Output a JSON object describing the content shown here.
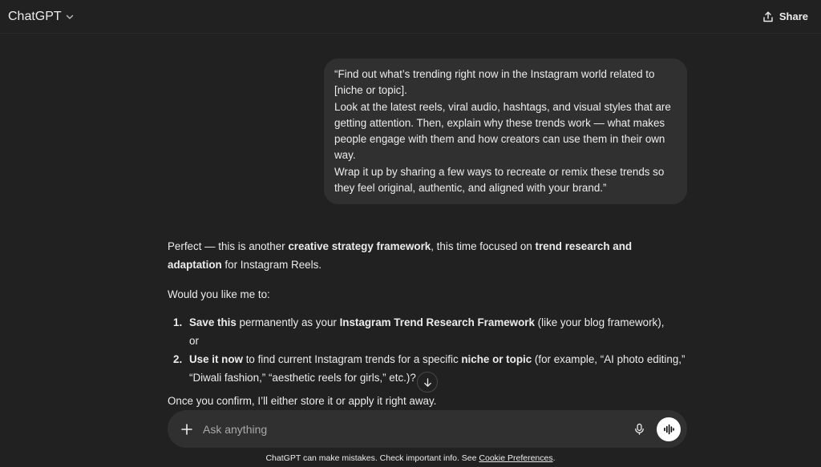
{
  "header": {
    "model_name": "ChatGPT",
    "share_label": "Share"
  },
  "user_message": {
    "lines": [
      "“Find out what’s trending right now in the Instagram world related to [niche or topic].",
      "Look at the latest reels, viral audio, hashtags, and visual styles that are getting attention. Then, explain why these trends work — what makes people engage with them and how creators can use them in their own way.",
      "Wrap it up by sharing a few ways to recreate or remix these trends so they feel original, authentic, and aligned with your brand.”"
    ]
  },
  "assistant_message": {
    "intro_1": "Perfect — this is another ",
    "intro_bold_1": "creative strategy framework",
    "intro_2": ", this time focused on ",
    "intro_bold_2": "trend research and adaptation",
    "intro_3": " for Instagram Reels.",
    "question": "Would you like me to:",
    "options": [
      {
        "number": "1.",
        "bold_lead": "Save this",
        "text_1": " permanently as your ",
        "bold_mid": "Instagram Trend Research Framework",
        "text_2": " (like your blog framework),",
        "trailing": "or"
      },
      {
        "number": "2.",
        "bold_lead": "Use it now",
        "text_1": " to find current Instagram trends for a specific ",
        "bold_mid": "niche or topic",
        "text_2": " (for example, “AI photo editing,” “Diwali fashion,” “aesthetic reels for girls,” etc.)?"
      }
    ],
    "confirm": "Once you confirm, I’ll either store it or apply it right away."
  },
  "composer": {
    "placeholder": "Ask anything"
  },
  "footer": {
    "note": "ChatGPT can make mistakes. Check important info. See ",
    "link": "Cookie Preferences",
    "end": "."
  },
  "icons": {
    "model_dropdown": "chevron-down-icon",
    "share": "share-icon",
    "scroll": "arrow-down-icon",
    "attach": "plus-icon",
    "dictate": "microphone-icon",
    "voice": "voice-mode-icon"
  },
  "colors": {
    "background": "#212121",
    "bubble": "#303030",
    "text": "#ececec",
    "voice_button": "#ffffff"
  }
}
